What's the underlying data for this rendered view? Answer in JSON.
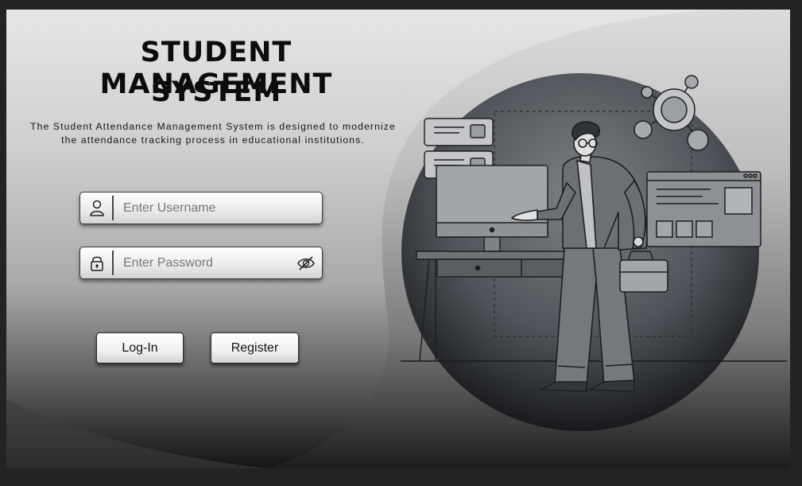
{
  "header": {
    "title_line1": "STUDENT MANAGEMENT",
    "title_line2": "SYSTEM",
    "subtitle": "The Student Attendance Management System is designed to modernize the attendance tracking process in educational institutions."
  },
  "form": {
    "username": {
      "placeholder": "Enter Username",
      "value": "",
      "icon": "user-icon"
    },
    "password": {
      "placeholder": "Enter Password",
      "value": "",
      "icon": "lock-icon",
      "toggle_icon": "eye-slash-icon"
    }
  },
  "actions": {
    "login_label": "Log-In",
    "register_label": "Register"
  },
  "illustration": {
    "subject": "person presenting at a desktop monitor",
    "icons": [
      "chat-bubble-icon",
      "monitor-icon",
      "network-nodes-icon",
      "browser-window-icon",
      "briefcase-icon",
      "desk-icon"
    ]
  },
  "colors": {
    "page_background": "#232323",
    "text": "#0c0c0c",
    "button_background": "#f0f0f0",
    "illustration_circle": "#2c2c2c"
  }
}
